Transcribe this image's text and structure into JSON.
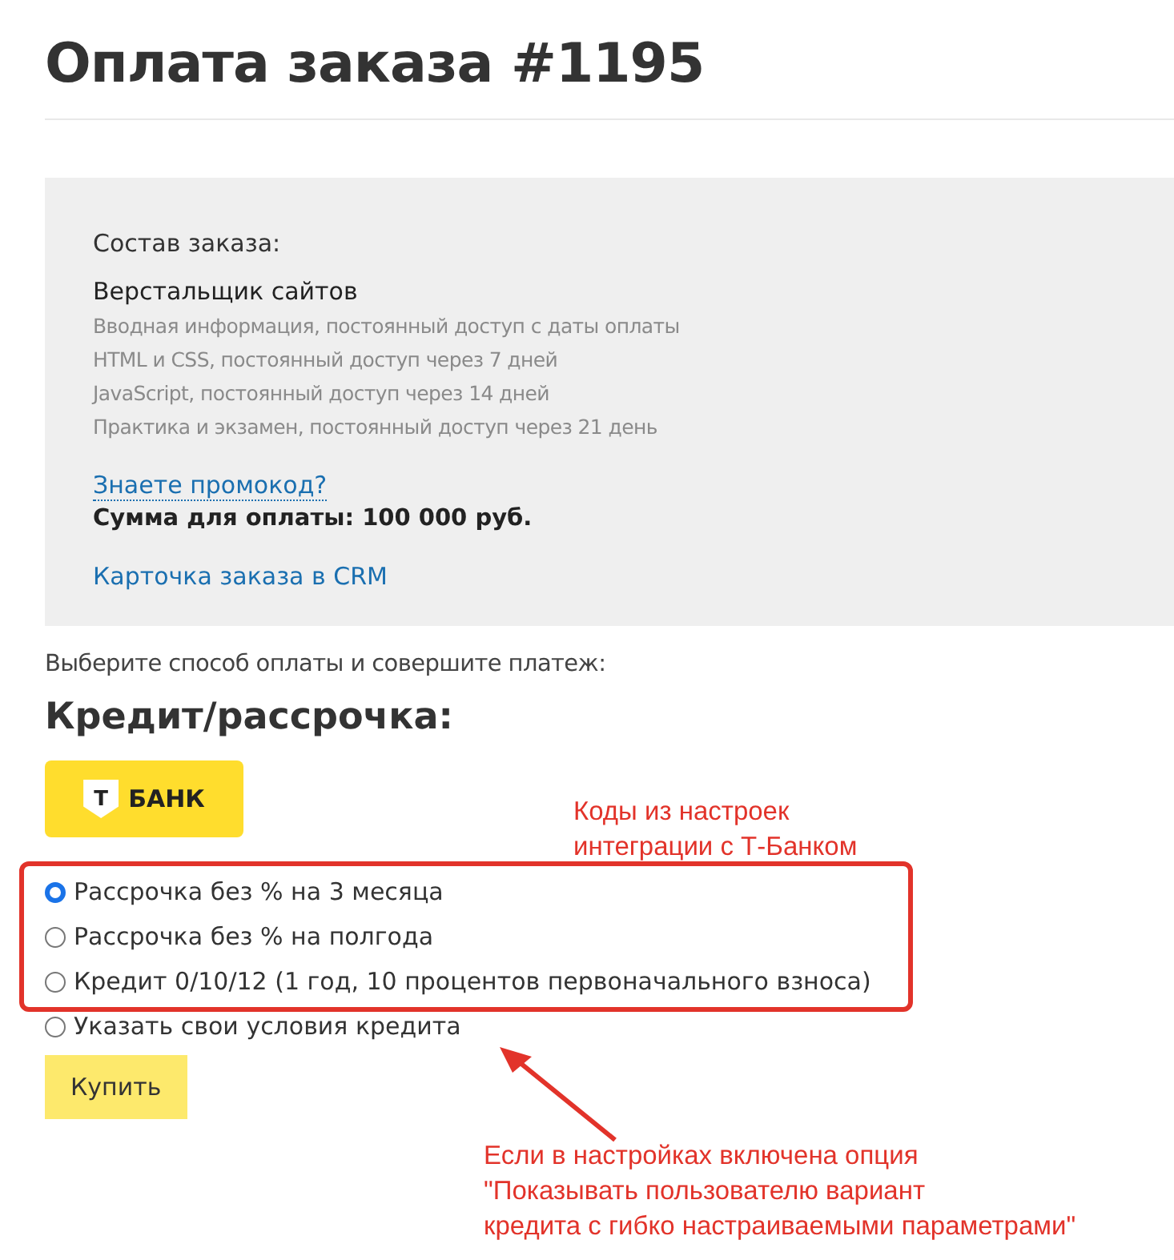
{
  "title": "Оплата заказа #1195",
  "order": {
    "heading": "Состав заказа:",
    "product": "Верстальщик сайтов",
    "items": [
      "Вводная информация, постоянный доступ с даты оплаты",
      "HTML и CSS, постоянный доступ через 7 дней",
      "JavaScript, постоянный доступ через 14 дней",
      "Практика и экзамен, постоянный доступ через 21 день"
    ],
    "promo_link": "Знаете промокод?",
    "total": "Сумма для оплаты: 100 000 руб.",
    "crm_link": "Карточка заказа в CRM"
  },
  "prompt": "Выберите способ оплаты и совершите платеж:",
  "section_title": "Кредит/рассрочка:",
  "bank_logo": {
    "mark": "Т",
    "name": "БАНК"
  },
  "options": [
    {
      "label": "Рассрочка без % на 3 месяца",
      "selected": true,
      "kind": "bank"
    },
    {
      "label": "Рассрочка без % на полгода",
      "selected": false,
      "kind": "bank"
    },
    {
      "label": "Кредит 0/10/12 (1 год, 10 процентов первоначального взноса)",
      "selected": false,
      "kind": "bank"
    },
    {
      "label": "Указать свои условия кредита",
      "selected": false,
      "kind": "custom"
    }
  ],
  "buy_button": "Купить",
  "annotations": [
    {
      "kind": "box",
      "text": "Коды из настроек\nинтеграции с Т-Банком"
    },
    {
      "kind": "arrow",
      "text": "Если в настройках включена опция\n\"Показывать пользователю вариант\nкредита с гибко настраиваемыми параметрами\""
    }
  ]
}
